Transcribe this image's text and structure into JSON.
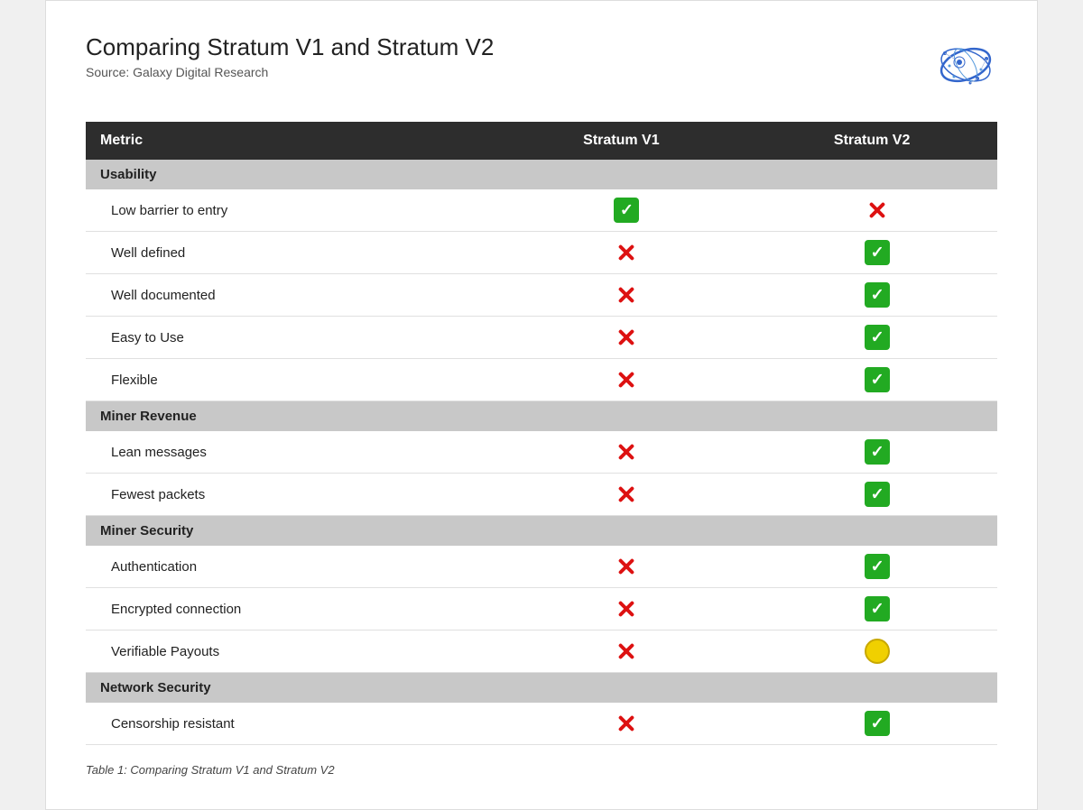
{
  "header": {
    "main_title": "Comparing Stratum V1 and Stratum V2",
    "subtitle": "Source: Galaxy Digital Research"
  },
  "table": {
    "columns": [
      "Metric",
      "Stratum V1",
      "Stratum V2"
    ],
    "sections": [
      {
        "section_label": "Usability",
        "rows": [
          {
            "metric": "Low barrier to entry",
            "v1": "check",
            "v2": "cross"
          },
          {
            "metric": "Well defined",
            "v1": "cross",
            "v2": "check"
          },
          {
            "metric": "Well documented",
            "v1": "cross",
            "v2": "check"
          },
          {
            "metric": "Easy to Use",
            "v1": "cross",
            "v2": "check"
          },
          {
            "metric": "Flexible",
            "v1": "cross",
            "v2": "check"
          }
        ]
      },
      {
        "section_label": "Miner Revenue",
        "rows": [
          {
            "metric": "Lean messages",
            "v1": "cross",
            "v2": "check"
          },
          {
            "metric": "Fewest packets",
            "v1": "cross",
            "v2": "check"
          }
        ]
      },
      {
        "section_label": "Miner Security",
        "rows": [
          {
            "metric": "Authentication",
            "v1": "cross",
            "v2": "check"
          },
          {
            "metric": "Encrypted connection",
            "v1": "cross",
            "v2": "check"
          },
          {
            "metric": "Verifiable Payouts",
            "v1": "cross",
            "v2": "circle"
          }
        ]
      },
      {
        "section_label": "Network Security",
        "rows": [
          {
            "metric": "Censorship resistant",
            "v1": "cross",
            "v2": "check"
          }
        ]
      }
    ]
  },
  "footer": {
    "caption": "Table 1: Comparing Stratum V1 and Stratum V2"
  }
}
